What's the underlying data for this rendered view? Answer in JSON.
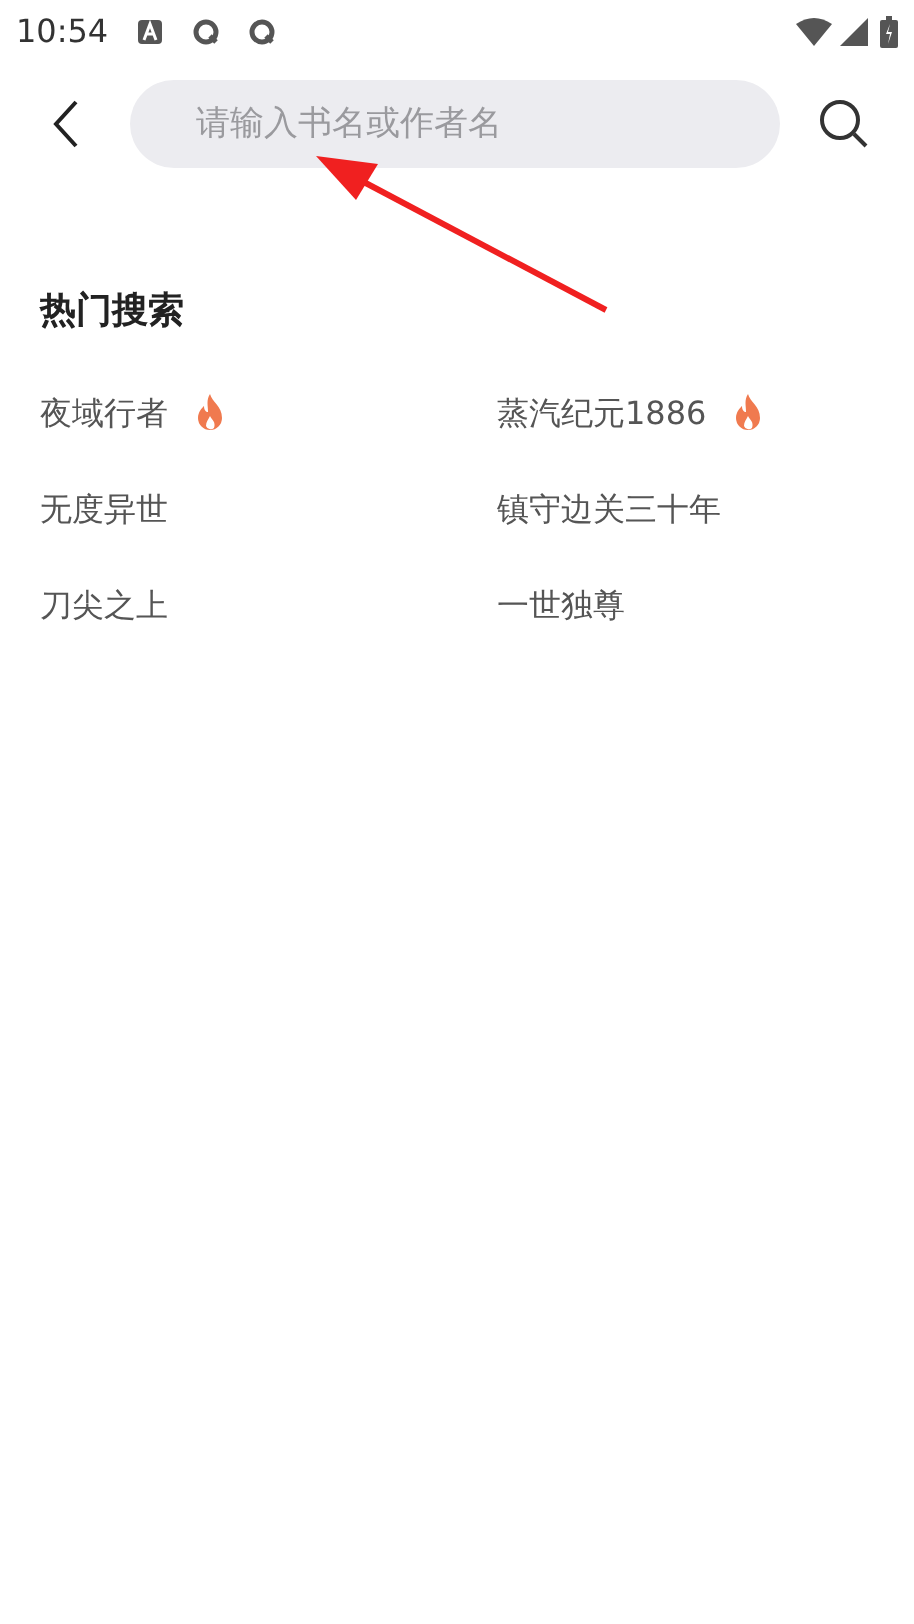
{
  "status_bar": {
    "time": "10:54"
  },
  "search": {
    "placeholder": "请输入书名或作者名"
  },
  "hot_searches": {
    "title": "热门搜索",
    "items": [
      {
        "label": "夜域行者",
        "hot": true
      },
      {
        "label": "蒸汽纪元1886",
        "hot": true
      },
      {
        "label": "无度异世",
        "hot": false
      },
      {
        "label": "镇守边关三十年",
        "hot": false
      },
      {
        "label": "刀尖之上",
        "hot": false
      },
      {
        "label": "一世独尊",
        "hot": false
      }
    ]
  }
}
